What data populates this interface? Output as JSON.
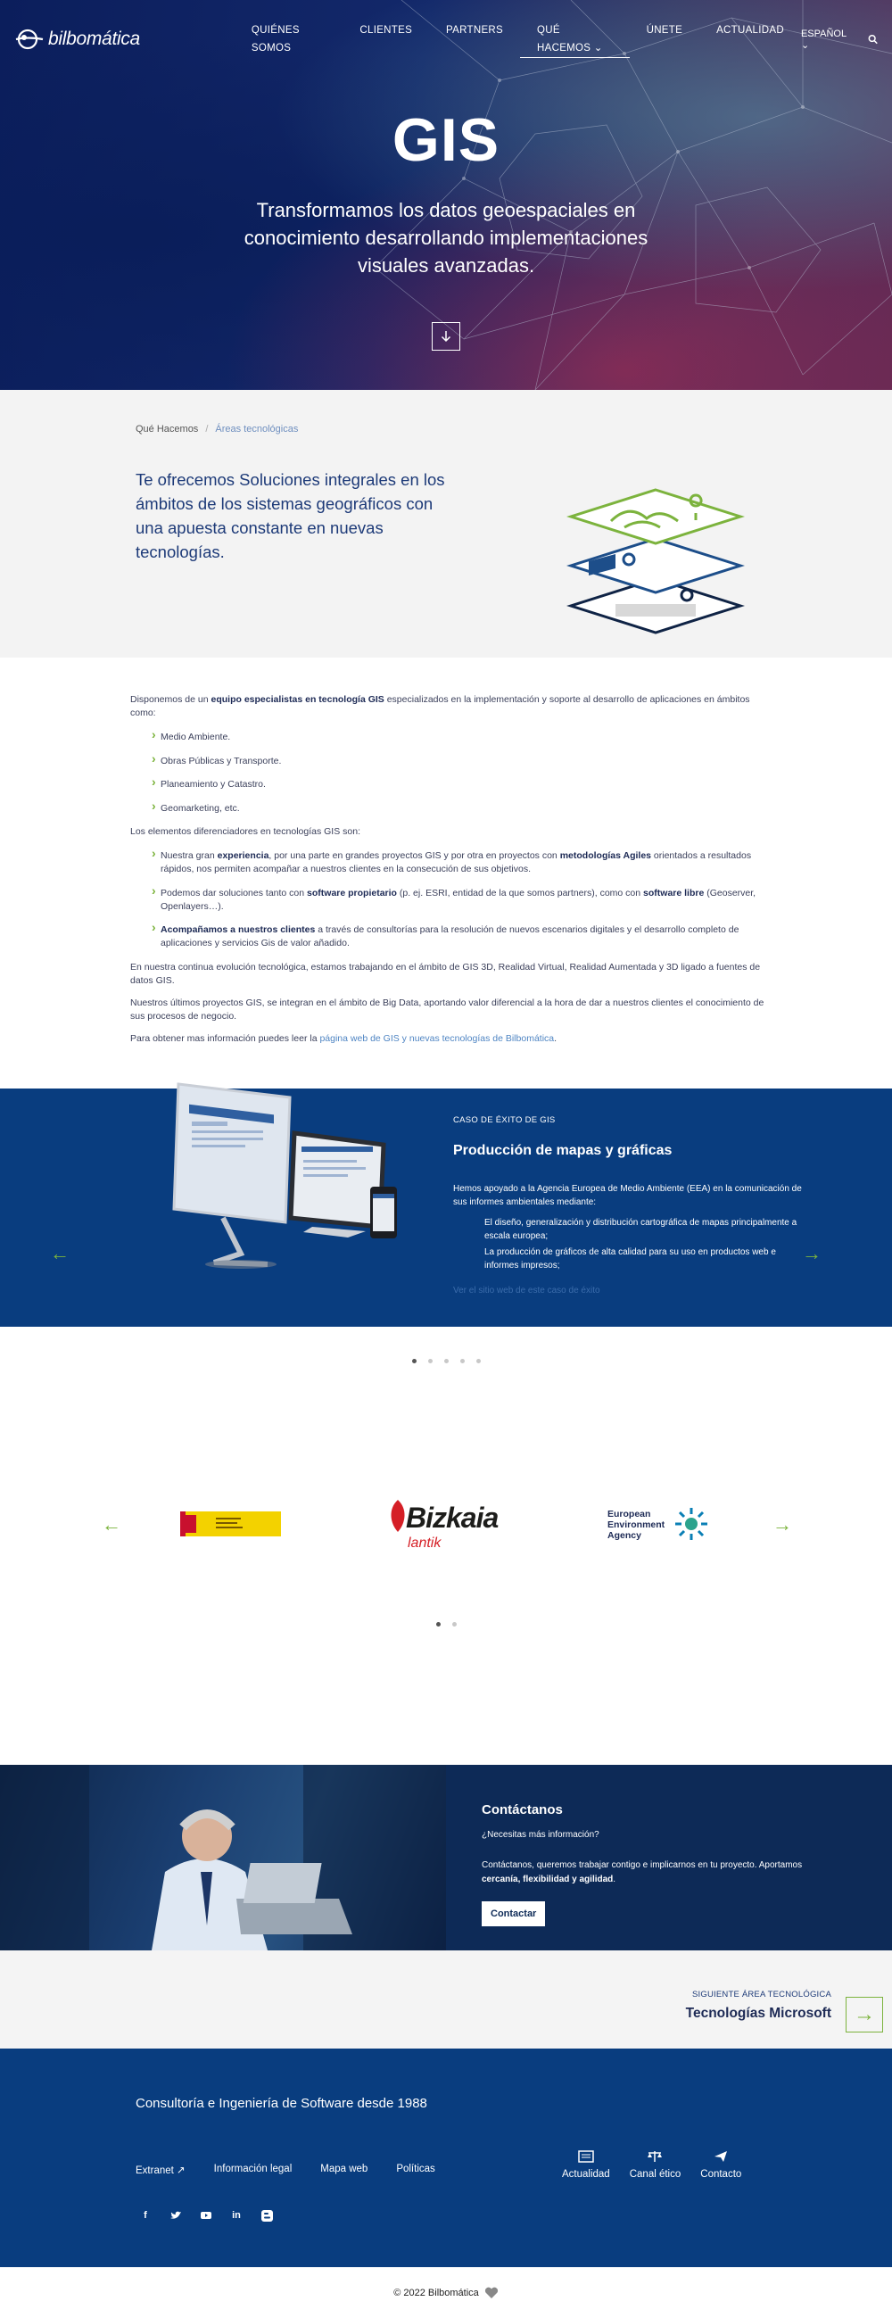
{
  "nav": {
    "brand": "bilbomática",
    "items": [
      {
        "label": "QUIÉNES SOMOS"
      },
      {
        "label": "CLIENTES"
      },
      {
        "label": "PARTNERS"
      },
      {
        "label": "QUÉ HACEMOS"
      },
      {
        "label": "ÚNETE"
      },
      {
        "label": "ACTUALIDAD"
      }
    ],
    "language": "ESPAÑOL"
  },
  "hero": {
    "title": "GIS",
    "subtitle": "Transformamos los datos geoespaciales en conocimiento desarrollando implementaciones visuales avanzadas."
  },
  "breadcrumb": {
    "root": "Qué Hacemos",
    "current": "Áreas tecnológicas"
  },
  "intro": {
    "text": "Te ofrecemos Soluciones integrales en los ámbitos de los sistemas geográficos con una apuesta constante en nuevas tecnologías."
  },
  "content": {
    "p1_pre": "Disponemos de un ",
    "p1_bold": "equipo especialistas en tecnología GIS",
    "p1_post": " especializados en la implementación y soporte al desarrollo de aplicaciones en ámbitos como:",
    "areas": [
      "Medio Ambiente.",
      "Obras Públicas y Transporte.",
      "Planeamiento y Catastro.",
      "Geomarketing, etc."
    ],
    "p2": "Los elementos diferenciadores en tecnologías GIS son:",
    "d1_pre": "Nuestra gran ",
    "d1_b1": "experiencia",
    "d1_mid": ", por una parte en grandes proyectos GIS y por otra en proyectos con ",
    "d1_b2": "metodologías Agiles",
    "d1_post": " orientados a resultados rápidos, nos permiten acompañar a nuestros clientes en la consecución de sus objetivos.",
    "d2_pre": "Podemos dar soluciones tanto con ",
    "d2_b1": "software propietario",
    "d2_mid": " (p. ej. ESRI, entidad de la que somos partners), como con ",
    "d2_b2": "software libre",
    "d2_post": " (Geoserver, Openlayers…).",
    "d3_b": "Acompañamos a nuestros clientes",
    "d3_post": " a través de consultorías para la resolución de nuevos escenarios digitales y el desarrollo completo de aplicaciones y servicios Gis de valor añadido.",
    "p3": "En nuestra continua evolución tecnológica, estamos trabajando en el ámbito de GIS 3D, Realidad Virtual, Realidad Aumentada y 3D ligado a fuentes de datos GIS.",
    "p4": "Nuestros últimos proyectos GIS, se integran en el ámbito de Big Data, aportando valor diferencial a la hora de dar a nuestros clientes el conocimiento de sus procesos de negocio.",
    "p5_pre": "Para obtener mas información puedes leer la ",
    "p5_link": "página web de GIS y nuevas tecnologías de Bilbomática",
    "p5_post": "."
  },
  "case": {
    "label": "CASO DE ÉXITO DE GIS",
    "title": "Producción de mapas y gráficas",
    "body": "Hemos apoyado a la Agencia Europea de Medio Ambiente (EEA) en la comunicación de sus informes ambientales mediante:",
    "bullet1": "El diseño, generalización y distribución cartográfica de mapas principalmente a escala europea;",
    "bullet2": "La producción de gráficos de alta calidad para su uso en productos web e informes impresos;",
    "link": "Ver el sitio web de este caso de éxito"
  },
  "partners": {
    "bizkaia": "Bizkaia",
    "bizkaia_sub": "lantik",
    "eea_line1": "European",
    "eea_line2": "Environment",
    "eea_line3": "Agency"
  },
  "contact": {
    "title": "Contáctanos",
    "question": "¿Necesitas más información?",
    "text_pre": "Contáctanos, queremos trabajar contigo e implicarnos en tu proyecto. Aportamos ",
    "text_bold": "cercanía, flexibilidad y agilidad",
    "text_post": ".",
    "button": "Contactar"
  },
  "next_area": {
    "label": "SIGUIENTE ÁREA TECNOLÓGICA",
    "title": "Tecnologías Microsoft"
  },
  "footer": {
    "tagline": "Consultoría e Ingeniería de Software desde 1988",
    "links": [
      "Extranet",
      "Información legal",
      "Mapa web",
      "Políticas"
    ],
    "right": [
      "Actualidad",
      "Canal ético",
      "Contacto"
    ],
    "copyright": "© 2022 Bilbomática"
  },
  "colors": {
    "navy": "#093d7f",
    "green": "#7cb33d",
    "dark_navy": "#0d2a57"
  }
}
